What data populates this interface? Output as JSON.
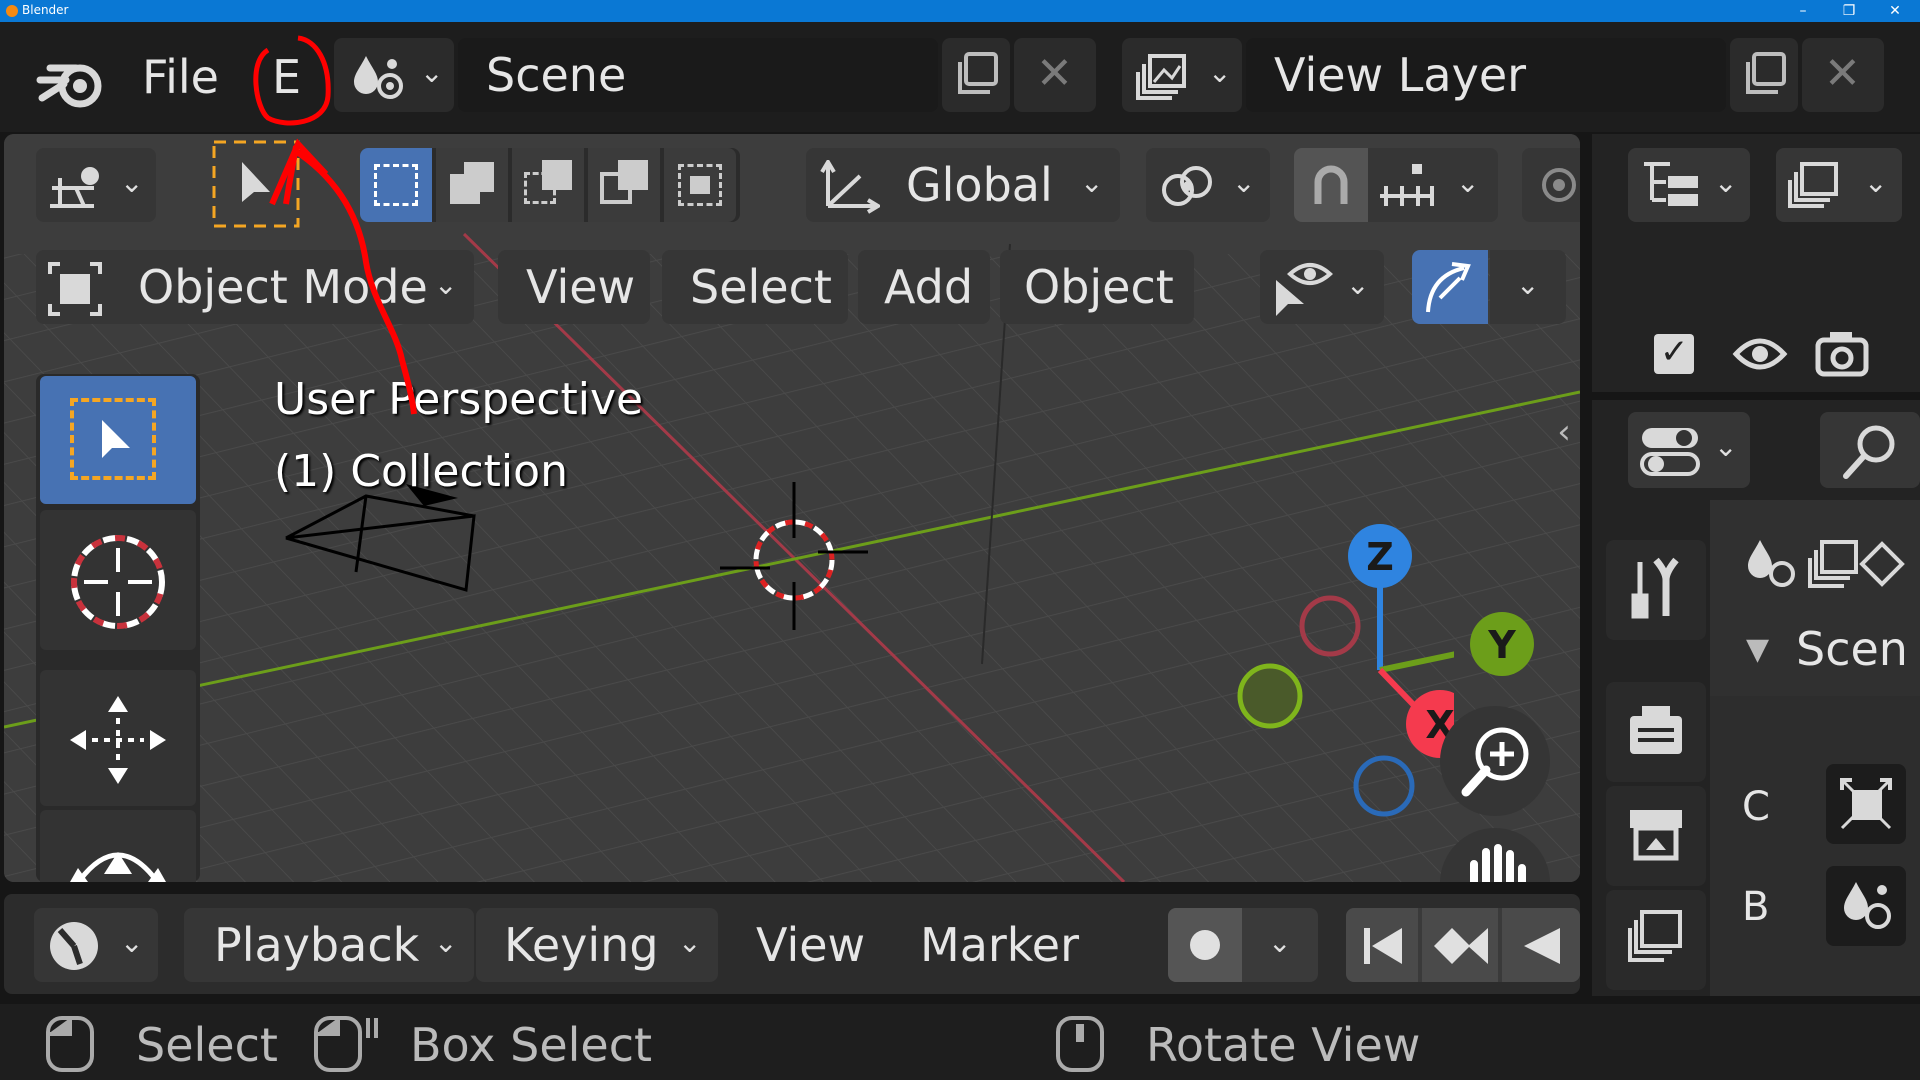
{
  "window": {
    "title": "Blender",
    "minimize": "–",
    "maximize": "❐",
    "close": "✕"
  },
  "topbar": {
    "menu_file": "File",
    "menu_edit": "E",
    "scene_name": "Scene",
    "view_layer": "View Layer"
  },
  "viewport_header": {
    "orientation": "Global",
    "mode": "Object Mode",
    "menus": [
      "View",
      "Select",
      "Add",
      "Object"
    ]
  },
  "viewport": {
    "perspective_label": "User Perspective",
    "collection_label": "(1) Collection",
    "gizmo": {
      "z": "Z",
      "y": "Y",
      "x": "X"
    }
  },
  "properties": {
    "scene_heading": "Scen",
    "row_c": "C",
    "row_b": "B"
  },
  "timeline": {
    "menus": [
      "Playback",
      "Keying",
      "View",
      "Marker"
    ]
  },
  "statusbar": {
    "select": "Select",
    "box_select": "Box Select",
    "rotate_view": "Rotate View"
  },
  "colors": {
    "accent_blue": "#4772b3",
    "axis_x": "#f53a4e",
    "axis_y": "#6c9e1a",
    "axis_z": "#2f84e0",
    "annotation_red": "#ff0000",
    "select_dash": "#f5a623"
  },
  "annotation": {
    "description_icon": "red-circle-and-arrow-annotation"
  }
}
